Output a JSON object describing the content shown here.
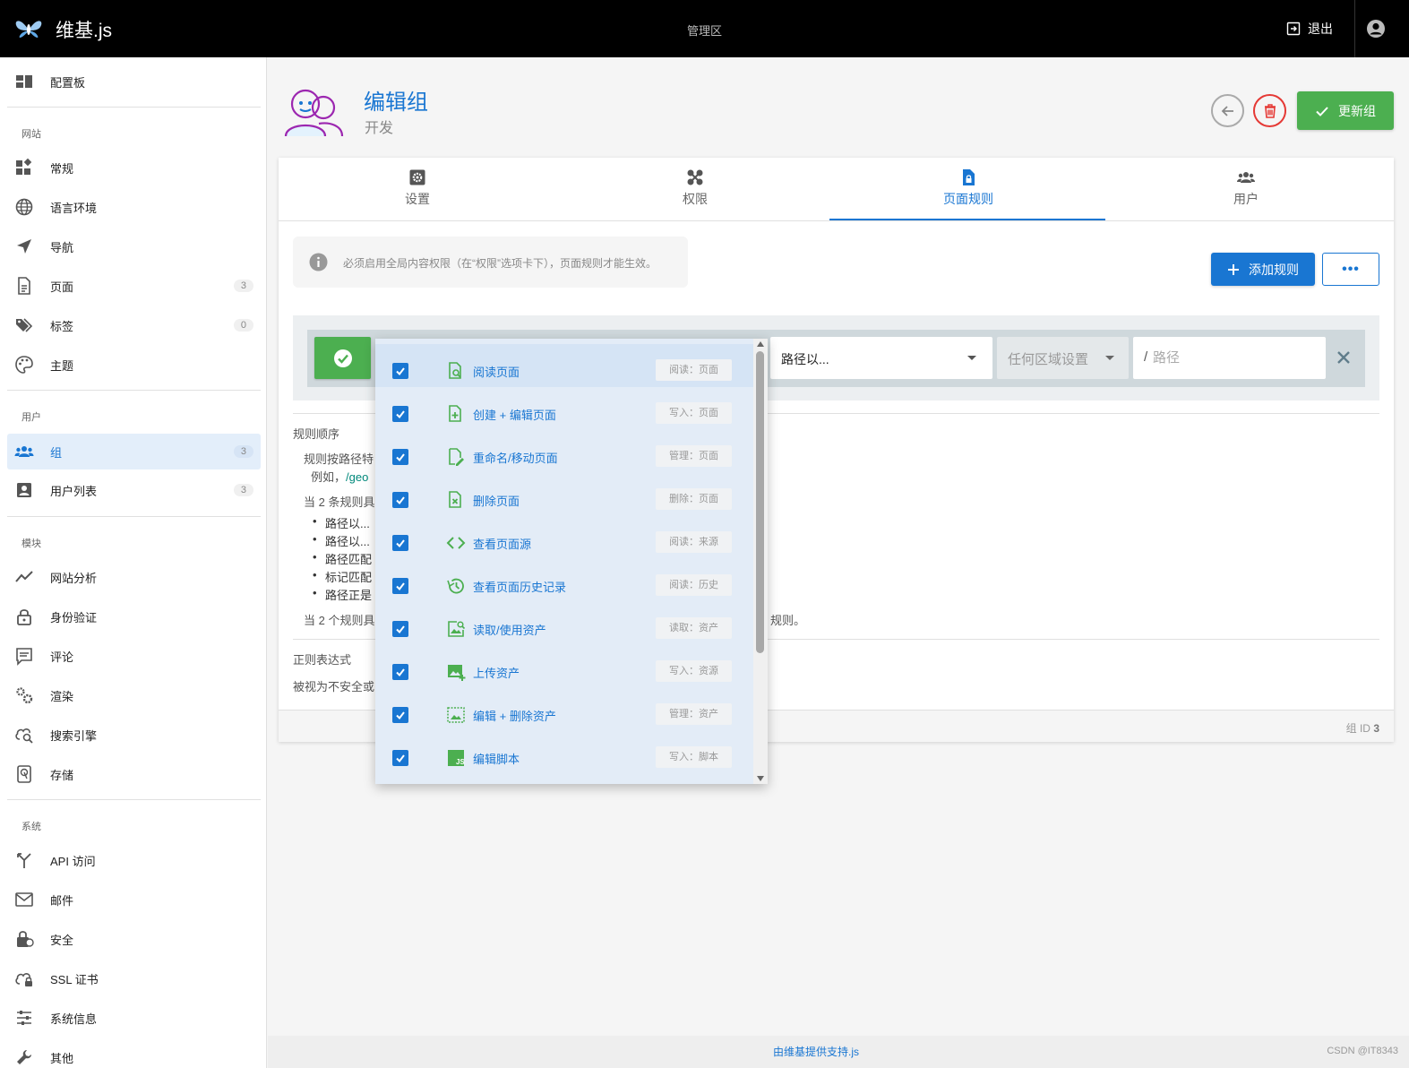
{
  "topbar": {
    "app_title": "维基.js",
    "admin_label": "管理区",
    "logout_label": "退出"
  },
  "sidebar": {
    "dashboard": "配置板",
    "sections": {
      "site": "网站",
      "users": "用户",
      "modules": "模块",
      "system": "系统"
    },
    "items": {
      "general": "常规",
      "locale": "语言环境",
      "navigation": "导航",
      "pages": {
        "label": "页面",
        "count": "3"
      },
      "tags": {
        "label": "标签",
        "count": "0"
      },
      "theme": "主题",
      "groups": {
        "label": "组",
        "count": "3"
      },
      "user_list": {
        "label": "用户列表",
        "count": "3"
      },
      "analytics": "网站分析",
      "auth": "身份验证",
      "comments": "评论",
      "rendering": "渲染",
      "search": "搜索引擎",
      "storage": "存储",
      "api": "API 访问",
      "mail": "邮件",
      "security": "安全",
      "ssl": "SSL 证书",
      "sysinfo": "系统信息",
      "other": "其他"
    }
  },
  "header": {
    "title": "编辑组",
    "subtitle": "开发",
    "update_label": "更新组"
  },
  "tabs": [
    {
      "label": "设置"
    },
    {
      "label": "权限"
    },
    {
      "label": "页面规则"
    },
    {
      "label": "用户"
    }
  ],
  "rules": {
    "alert": "必须启用全局内容权限（在“权限”选项卡下），页面规则才能生效。",
    "add_rule_label": "添加规则",
    "more_label": "•••",
    "match_value": "路径以...",
    "locale_value": "任何区域设置",
    "path_prefix": "/",
    "path_placeholder": "路径"
  },
  "order": {
    "heading": "规则顺序",
    "line1": "规则按路径特",
    "line2_prefix": "例如，",
    "line2_code": "/geo",
    "line3": "当 2 条规则具",
    "bullets": [
      "路径以...",
      "路径以...",
      "路径匹配",
      "标记匹配",
      "路径正是"
    ],
    "line4": "当 2 个规则具",
    "line4_tail": "规则。"
  },
  "regex": {
    "heading": "正则表达式",
    "line": "被视为不安全或"
  },
  "footer": {
    "group_id_label": "组 ID",
    "group_id_value": "3"
  },
  "permissions": [
    {
      "label": "阅读页面",
      "scope": "阅读：页面",
      "icon": "page-read-icon",
      "checked": true
    },
    {
      "label": "创建 + 编辑页面",
      "scope": "写入：页面",
      "icon": "page-add-icon",
      "checked": true
    },
    {
      "label": "重命名/移动页面",
      "scope": "管理：页面",
      "icon": "page-edit-icon",
      "checked": true
    },
    {
      "label": "删除页面",
      "scope": "删除：页面",
      "icon": "page-delete-icon",
      "checked": true
    },
    {
      "label": "查看页面源",
      "scope": "阅读：来源",
      "icon": "code-icon",
      "checked": true
    },
    {
      "label": "查看页面历史记录",
      "scope": "阅读：历史",
      "icon": "history-icon",
      "checked": true
    },
    {
      "label": "读取/使用资产",
      "scope": "读取：资产",
      "icon": "image-search-icon",
      "checked": true
    },
    {
      "label": "上传资产",
      "scope": "写入：资源",
      "icon": "image-upload-icon",
      "checked": true
    },
    {
      "label": "编辑 + 删除资产",
      "scope": "管理：资产",
      "icon": "image-edit-icon",
      "checked": true
    },
    {
      "label": "编辑脚本",
      "scope": "写入：脚本",
      "icon": "js-icon",
      "checked": true
    }
  ],
  "page_footer": {
    "powered_by": "由维基提供支持.js",
    "watermark": "CSDN @IT8343"
  },
  "colors": {
    "primary": "#1976d2",
    "success": "#4caf50",
    "danger": "#e53935",
    "topbar": "#000000"
  }
}
